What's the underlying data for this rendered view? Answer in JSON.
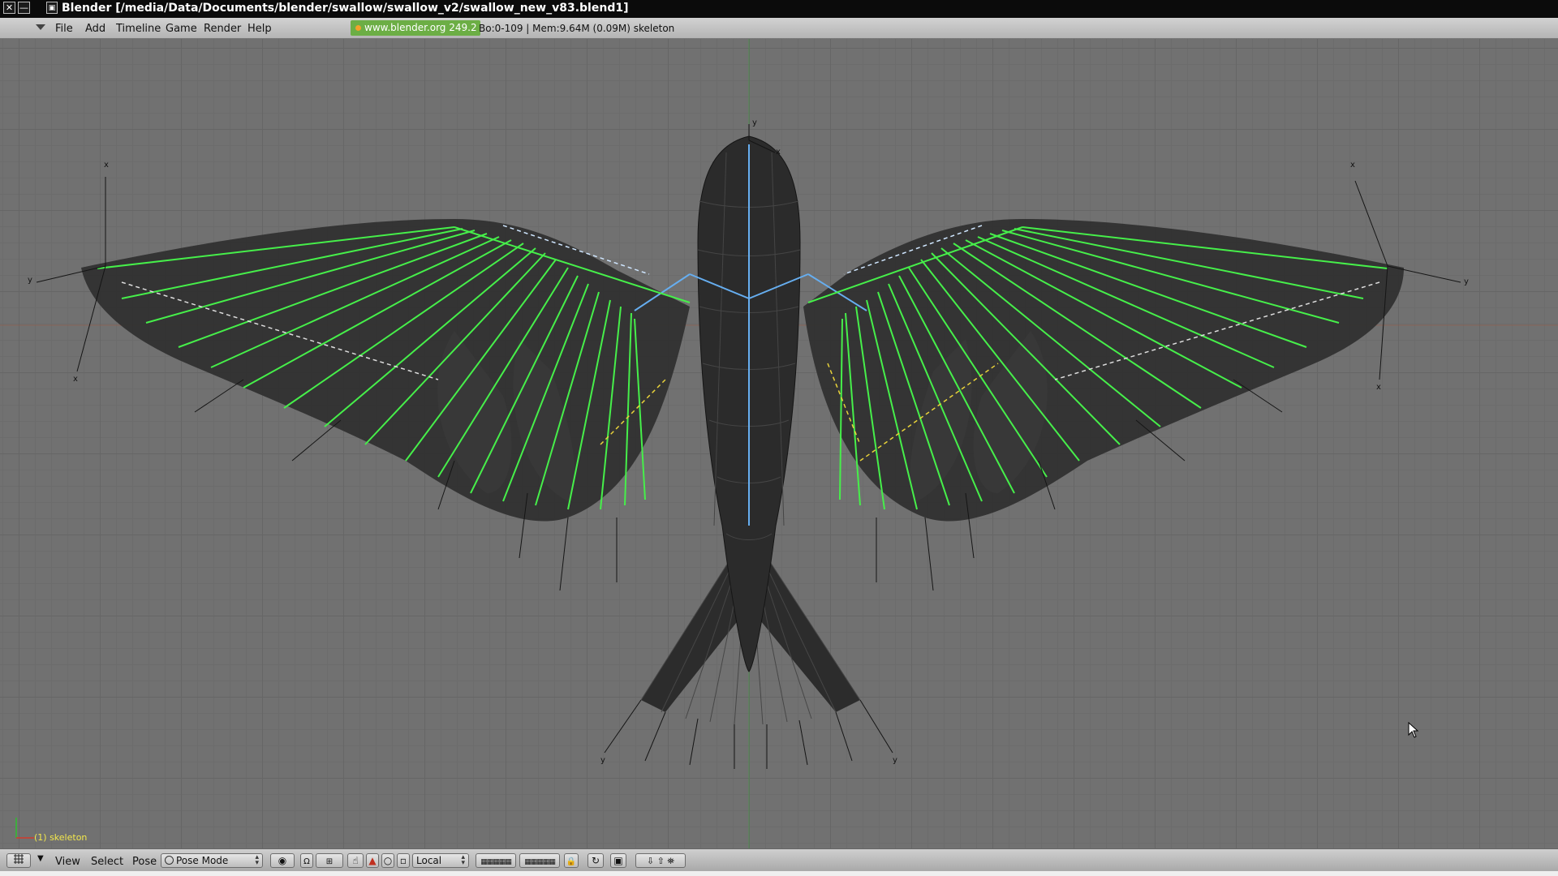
{
  "window": {
    "title": "Blender [/media/Data/Documents/blender/swallow/swallow_v2/swallow_new_v83.blend1]",
    "buttons": [
      "✕",
      "—",
      "▣"
    ]
  },
  "menubar": {
    "items": [
      "File",
      "Add",
      "Timeline",
      "Game",
      "Render",
      "Help"
    ],
    "site": "www.blender.org 249.2",
    "stats": "Bo:0-109  | Mem:9.64M (0.09M) skeleton"
  },
  "viewport": {
    "object_label": "(1) skeleton"
  },
  "bottombar": {
    "view": "View",
    "select": "Select",
    "pose": "Pose",
    "mode": "Pose Mode",
    "orientation": "Local"
  },
  "colors": {
    "viewport_bg": "#717171",
    "bone_green": "#46ef4a",
    "bone_blue": "#66aef0",
    "bone_yellow": "#e8d23a",
    "mesh": "#2f2f2f",
    "site_badge": "#6cae45"
  }
}
